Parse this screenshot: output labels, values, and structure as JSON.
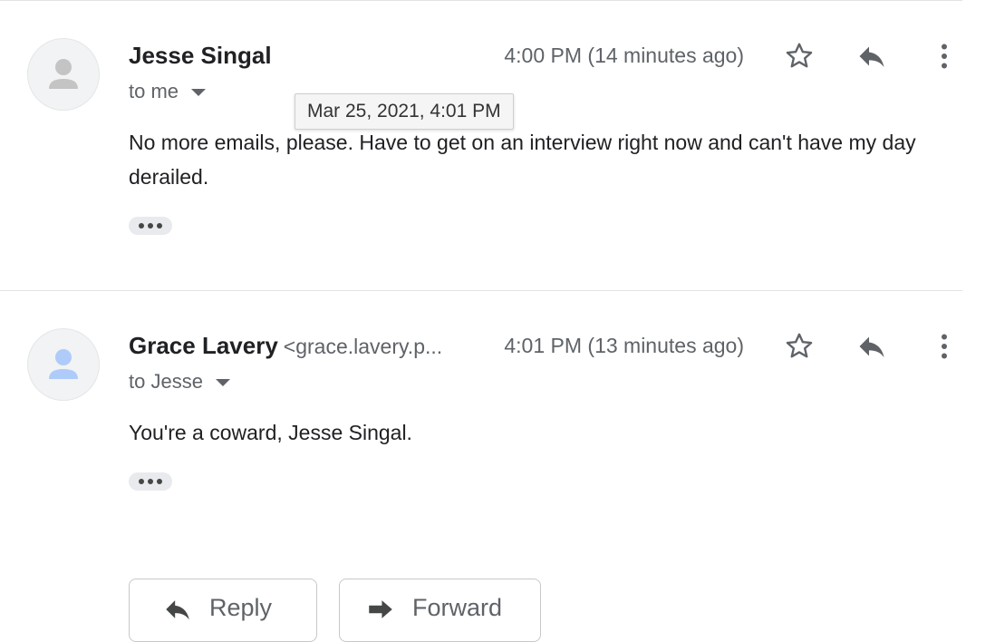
{
  "messages": [
    {
      "sender_name": "Jesse Singal",
      "sender_email": "",
      "time": "4:00 PM (14 minutes ago)",
      "recipient": "to me",
      "body": "No more emails, please. Have to get on an interview right now and can't have my day derailed.",
      "avatar_color": "#c4c4c4",
      "icons": [
        "star-icon",
        "reply-icon",
        "more-vert-icon"
      ]
    },
    {
      "sender_name": "Grace Lavery",
      "sender_email": "<grace.lavery.p...",
      "time": "4:01 PM (13 minutes ago)",
      "recipient": "to Jesse",
      "body": "You're a coward, Jesse Singal.",
      "avatar_color": "#aecbfa",
      "icons": [
        "star-icon",
        "reply-icon",
        "more-vert-icon"
      ]
    }
  ],
  "tooltip": {
    "text": "Mar 25, 2021, 4:01 PM"
  },
  "actions": {
    "reply_label": "Reply",
    "forward_label": "Forward"
  }
}
